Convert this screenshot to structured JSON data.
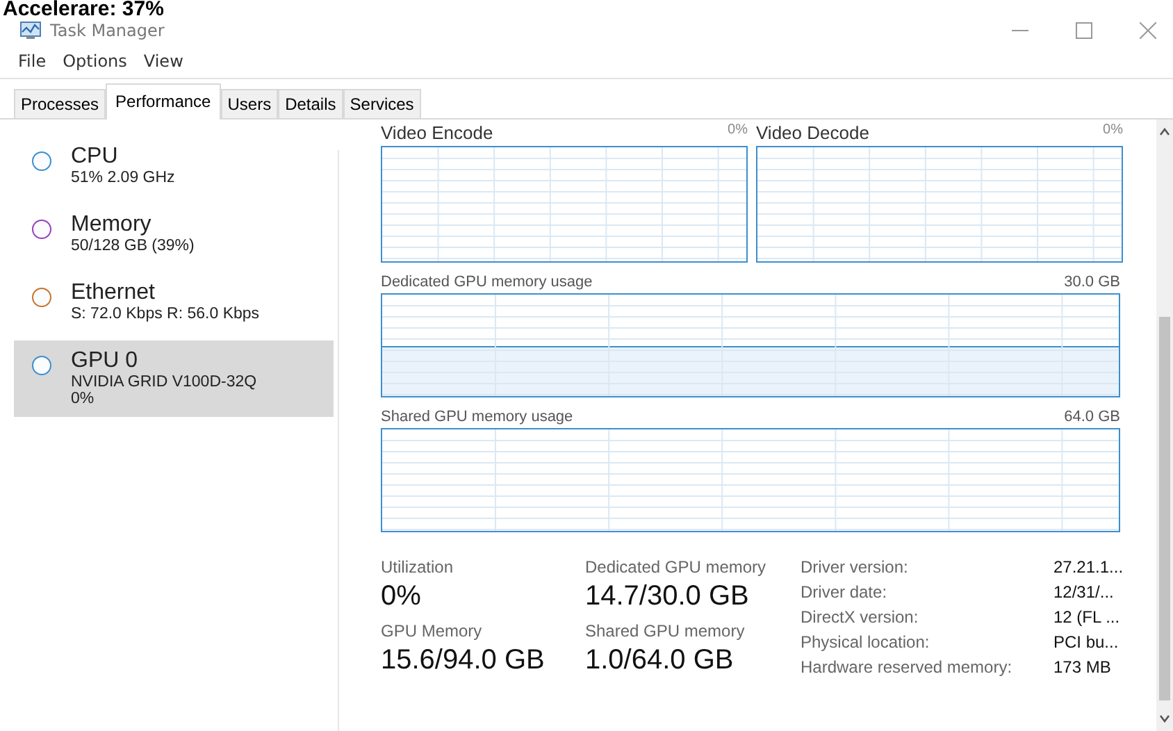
{
  "overlay_caption": "Accelerare: 37%",
  "window": {
    "title": "Task Manager"
  },
  "menu": [
    "File",
    "Options",
    "View"
  ],
  "tabs": [
    {
      "label": "Processes",
      "selected": false
    },
    {
      "label": "Performance",
      "selected": true
    },
    {
      "label": "Users",
      "selected": false
    },
    {
      "label": "Details",
      "selected": false
    },
    {
      "label": "Services",
      "selected": false
    }
  ],
  "sidebar": {
    "items": [
      {
        "name": "CPU",
        "detail": "51% 2.09 GHz",
        "color": "#3c8fcf",
        "selected": false
      },
      {
        "name": "Memory",
        "detail": "50/128 GB (39%)",
        "color": "#9b3fbf",
        "selected": false
      },
      {
        "name": "Ethernet",
        "detail": "S: 72.0 Kbps R: 56.0 Kbps",
        "color": "#c8742c",
        "selected": false
      },
      {
        "name": "GPU 0",
        "detail": "NVIDIA GRID V100D-32Q",
        "detail_2": "0%",
        "color": "#3c8fcf",
        "selected": true
      }
    ]
  },
  "graphs_top": [
    {
      "label": "Video Encode",
      "value": "0%"
    },
    {
      "label": "Video Decode",
      "value": "0%"
    }
  ],
  "graphs": [
    {
      "label": "Dedicated GPU memory usage",
      "max": "30.0 GB",
      "kind": "filled"
    },
    {
      "label": "Shared GPU memory usage",
      "max": "64.0 GB",
      "kind": "empty"
    }
  ],
  "stats": [
    {
      "label": "Utilization",
      "value": "0%"
    },
    {
      "label": "Dedicated GPU memory",
      "value": "14.7/30.0 GB"
    },
    {
      "label": "GPU Memory",
      "value": "15.6/94.0 GB"
    },
    {
      "label": "Shared GPU memory",
      "value": "1.0/64.0 GB"
    }
  ],
  "details": [
    {
      "key": "Driver version:",
      "value": "27.21.1..."
    },
    {
      "key": "Driver date:",
      "value": "12/31/..."
    },
    {
      "key": "DirectX version:",
      "value": "12 (FL ..."
    },
    {
      "key": "Physical location:",
      "value": "PCI bu..."
    },
    {
      "key": "Hardware reserved memory:",
      "value": "173 MB"
    }
  ]
}
